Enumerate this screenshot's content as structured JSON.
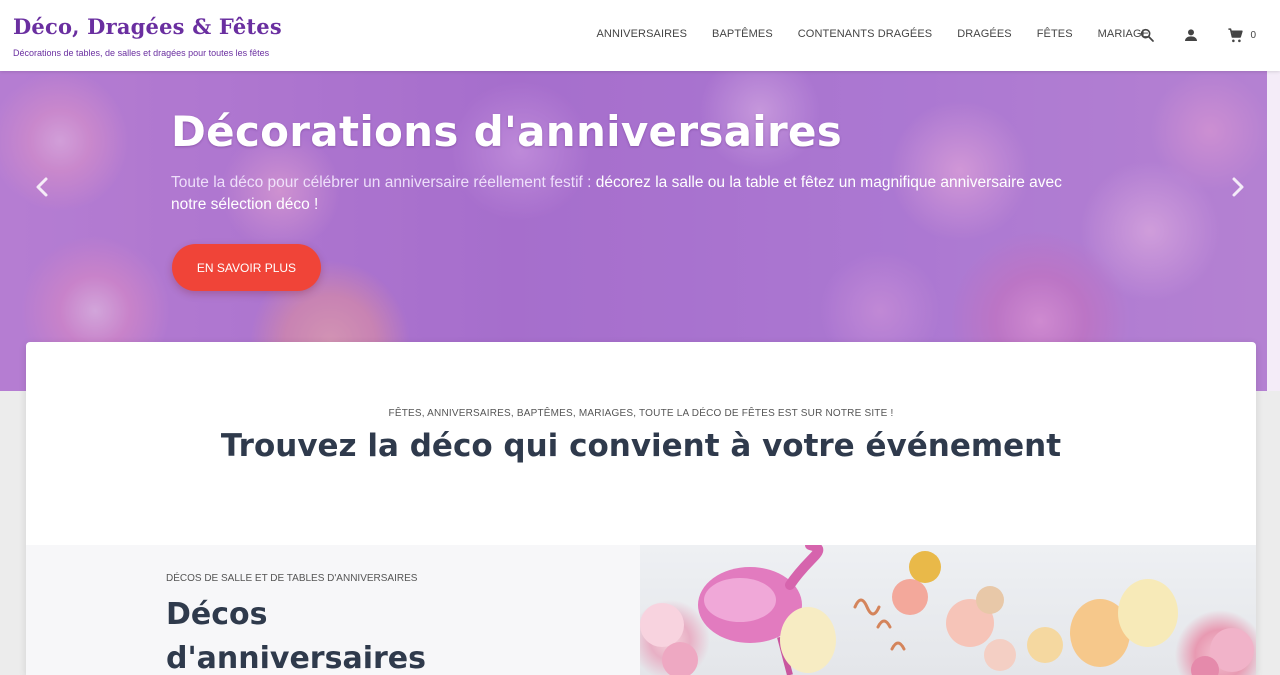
{
  "brand": {
    "title": "Déco, Dragées & Fêtes",
    "tagline": "Décorations de tables, de salles et dragées pour toutes les fêtes"
  },
  "nav": {
    "items": [
      {
        "label": "ANNIVERSAIRES"
      },
      {
        "label": "BAPTÊMES"
      },
      {
        "label": "CONTENANTS DRAGÉES"
      },
      {
        "label": "DRAGÉES"
      },
      {
        "label": "FÊTES"
      },
      {
        "label": "MARIAGE"
      }
    ]
  },
  "header_icons": {
    "search": "search-icon",
    "account": "user-icon",
    "cart": "cart-icon",
    "cart_count": "0"
  },
  "hero": {
    "title": "Décorations d'anniversaires",
    "text_part1": "Toute la déco pour célébrer un anniversaire réellement festif : ",
    "text_part2": "décorez la salle ou la table et fêtez un magnifique anniversaire avec notre sélection déco !",
    "cta_label": "EN SAVOIR PLUS",
    "prev_icon": "chevron-left-icon",
    "next_icon": "chevron-right-icon"
  },
  "section": {
    "eyebrow": "FÊTES, ANNIVERSAIRES, BAPTÊMES, MARIAGES, TOUTE LA DÉCO DE FÊTES EST SUR NOTRE SITE !",
    "title": "Trouvez la déco qui convient à votre événement"
  },
  "feature": {
    "eyebrow": "DÉCOS DE SALLE ET DE TABLES D'ANNIVERSAIRES",
    "title": "Décos d'anniversaires"
  },
  "colors": {
    "brand": "#6a2fa0",
    "cta": "#f04438",
    "heading": "#2f3a4c"
  }
}
